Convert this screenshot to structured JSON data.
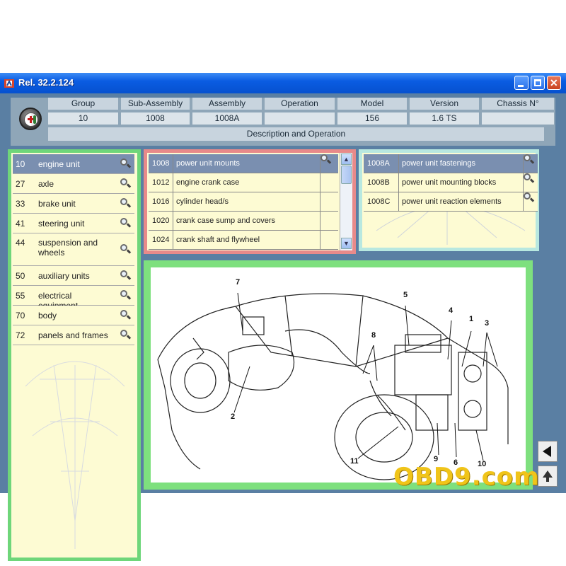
{
  "window": {
    "title": "Rel. 32.2.124"
  },
  "header": {
    "columns": [
      {
        "label": "Group",
        "value": "10"
      },
      {
        "label": "Sub-Assembly",
        "value": "1008"
      },
      {
        "label": "Assembly",
        "value": "1008A"
      },
      {
        "label": "Operation",
        "value": ""
      },
      {
        "label": "Model",
        "value": "156"
      },
      {
        "label": "Version",
        "value": "1.6 TS"
      },
      {
        "label": "Chassis N°",
        "value": ""
      }
    ],
    "description": "Description and Operation"
  },
  "groups": [
    {
      "code": "10",
      "label": "engine unit"
    },
    {
      "code": "27",
      "label": "axle"
    },
    {
      "code": "33",
      "label": "brake unit"
    },
    {
      "code": "41",
      "label": "steering unit"
    },
    {
      "code": "44",
      "label": "suspension and wheels"
    },
    {
      "code": "50",
      "label": "auxiliary units"
    },
    {
      "code": "55",
      "label": "electrical equipment"
    },
    {
      "code": "70",
      "label": "body"
    },
    {
      "code": "72",
      "label": "panels and frames"
    }
  ],
  "subassemblies": [
    {
      "code": "1008",
      "label": "power unit mounts"
    },
    {
      "code": "1012",
      "label": "engine crank case"
    },
    {
      "code": "1016",
      "label": "cylinder head/s"
    },
    {
      "code": "1020",
      "label": "crank case sump and covers"
    },
    {
      "code": "1024",
      "label": "crank shaft and flywheel"
    }
  ],
  "assemblies": [
    {
      "code": "1008A",
      "label": "power unit fastenings"
    },
    {
      "code": "1008B",
      "label": "power unit mounting blocks"
    },
    {
      "code": "1008C",
      "label": "power unit reaction elements"
    }
  ],
  "diagram": {
    "callouts": [
      "7",
      "5",
      "4",
      "1",
      "3",
      "8",
      "2",
      "11",
      "9",
      "6",
      "10"
    ]
  },
  "watermark": "OBD9.com",
  "icons": [
    "app-icon",
    "minimize-icon",
    "maximize-icon",
    "close-icon",
    "magnifier-icon",
    "scroll-up-icon",
    "scroll-down-icon",
    "arrow-left-icon",
    "arrow-up-icon",
    "alfa-romeo-logo"
  ]
}
